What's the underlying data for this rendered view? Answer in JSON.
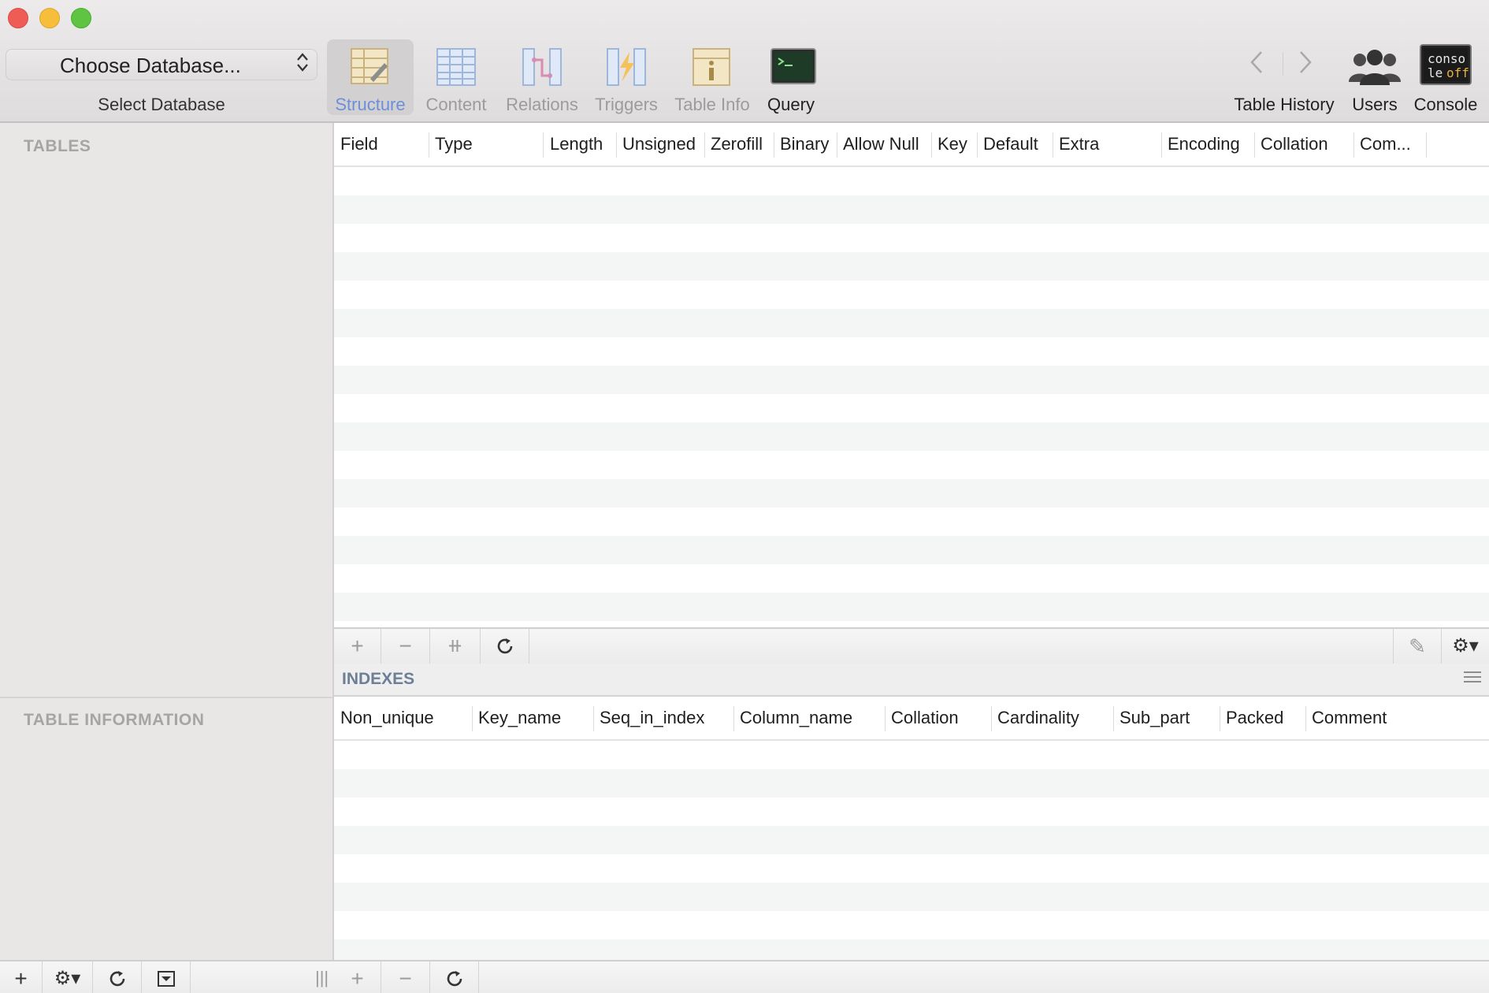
{
  "window": {
    "controls": [
      "close",
      "minimize",
      "zoom"
    ]
  },
  "database_selector": {
    "value": "Choose Database...",
    "label": "Select Database"
  },
  "toolbar": {
    "tabs": [
      {
        "id": "structure",
        "label": "Structure",
        "icon": "structure-icon",
        "active": true
      },
      {
        "id": "content",
        "label": "Content",
        "icon": "content-icon",
        "active": false
      },
      {
        "id": "relations",
        "label": "Relations",
        "icon": "relations-icon",
        "active": false
      },
      {
        "id": "triggers",
        "label": "Triggers",
        "icon": "triggers-icon",
        "active": false
      },
      {
        "id": "tableinfo",
        "label": "Table Info",
        "icon": "table-info-icon",
        "active": false
      },
      {
        "id": "query",
        "label": "Query",
        "icon": "query-icon",
        "active": false
      }
    ],
    "history_label": "Table History",
    "users_label": "Users",
    "console_label": "Console",
    "console_icon_text": "conso le off"
  },
  "sidebar": {
    "tables_title": "TABLES",
    "table_info_title": "TABLE INFORMATION"
  },
  "structure": {
    "columns": [
      "Field",
      "Type",
      "Length",
      "Unsigned",
      "Zerofill",
      "Binary",
      "Allow Null",
      "Key",
      "Default",
      "Extra",
      "Encoding",
      "Collation",
      "Com..."
    ],
    "rows": []
  },
  "indexes": {
    "title": "INDEXES",
    "columns": [
      "Non_unique",
      "Key_name",
      "Seq_in_index",
      "Column_name",
      "Collation",
      "Cardinality",
      "Sub_part",
      "Packed",
      "Comment"
    ],
    "rows": []
  },
  "glyphs": {
    "add": "+",
    "remove": "−",
    "duplicate": "⧺",
    "refresh": "↻",
    "gear": "⚙▾",
    "filter": "⊽",
    "resize": "|||",
    "pencil": "✎",
    "back": "‹",
    "forward": "›",
    "chevrons": "⌃⌄"
  },
  "colors": {
    "active_tab": "#6b8fdc",
    "indexes_title": "#6c7f96",
    "sidebar_bg": "#e9e6e6"
  }
}
